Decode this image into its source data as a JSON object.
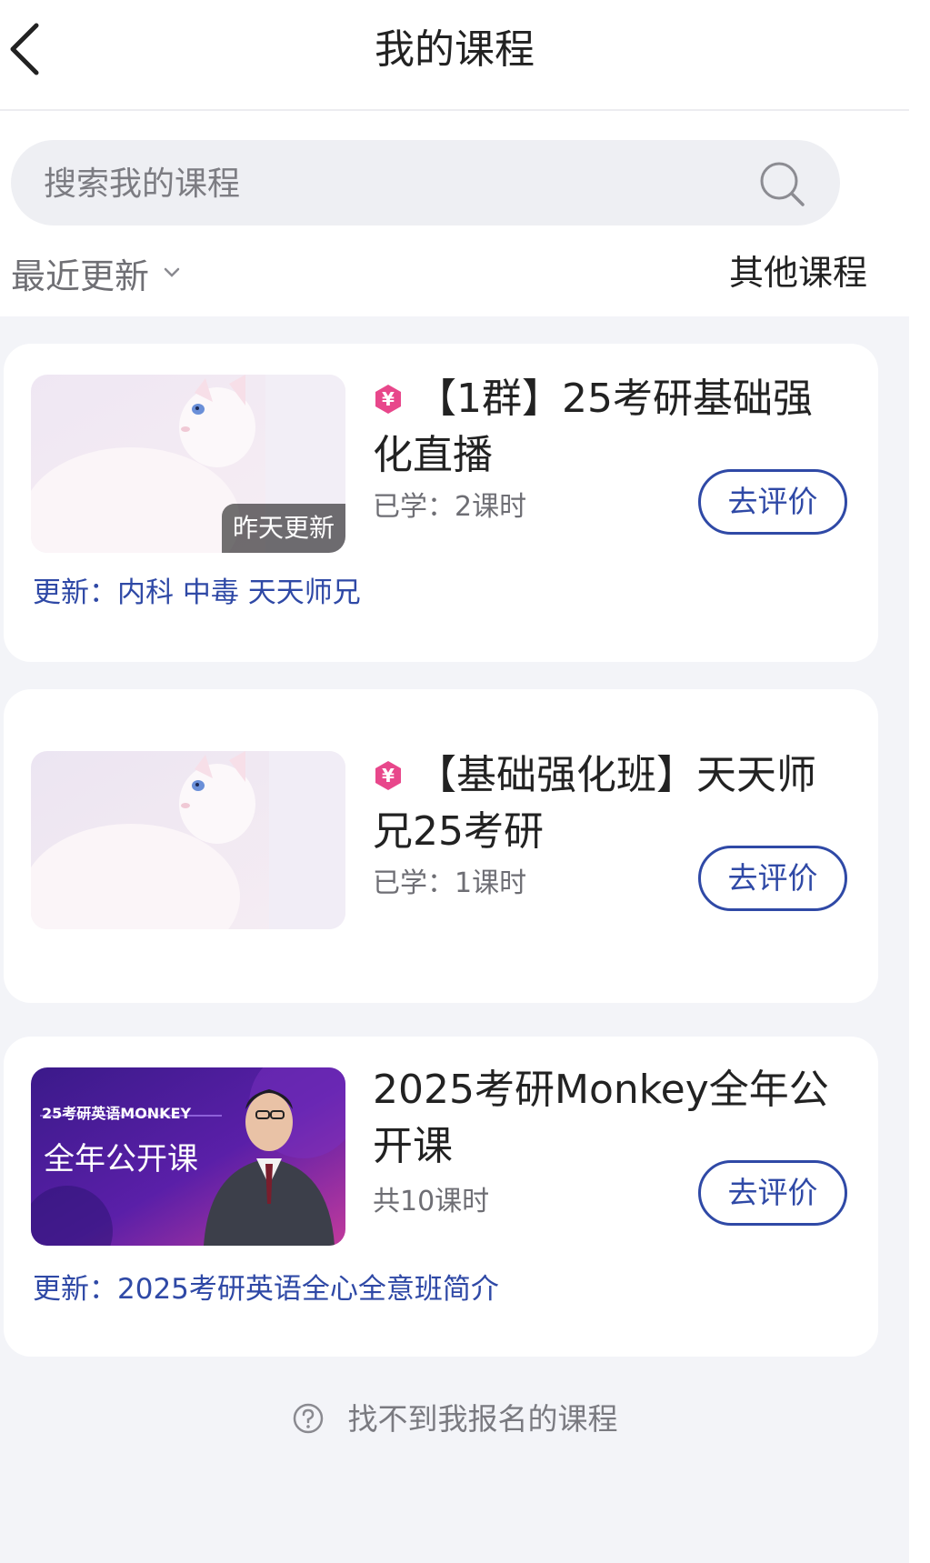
{
  "header": {
    "title": "我的课程",
    "back_icon": "chevron-left-icon"
  },
  "search": {
    "placeholder": "搜索我的课程"
  },
  "filter": {
    "sort_label": "最近更新",
    "other_courses_label": "其他课程"
  },
  "colors": {
    "accent": "#2f49a6",
    "badge_pink": "#e8478b",
    "page_bg": "#f3f4f8"
  },
  "courses": [
    {
      "badge_icon": "yen-icon",
      "title": "【1群】25考研基础强化直播",
      "progress": "已学：2课时",
      "thumb_badge": "昨天更新",
      "rate_label": "去评价",
      "update_label": "更新：",
      "update_text": "内科 中毒 天天师兄"
    },
    {
      "badge_icon": "yen-icon",
      "title": "【基础强化班】天天师兄25考研",
      "progress": "已学：1课时",
      "rate_label": "去评价"
    },
    {
      "title": "2025考研Monkey全年公开课",
      "progress": "共10课时",
      "rate_label": "去评价",
      "update_label": "更新：",
      "update_text": "2025考研英语全心全意班简介",
      "thumb_text_top": "25考研英语MONKEY",
      "thumb_text_main": "全年公开课"
    }
  ],
  "help": {
    "label": "找不到我报名的课程",
    "icon": "question-circle-icon"
  }
}
